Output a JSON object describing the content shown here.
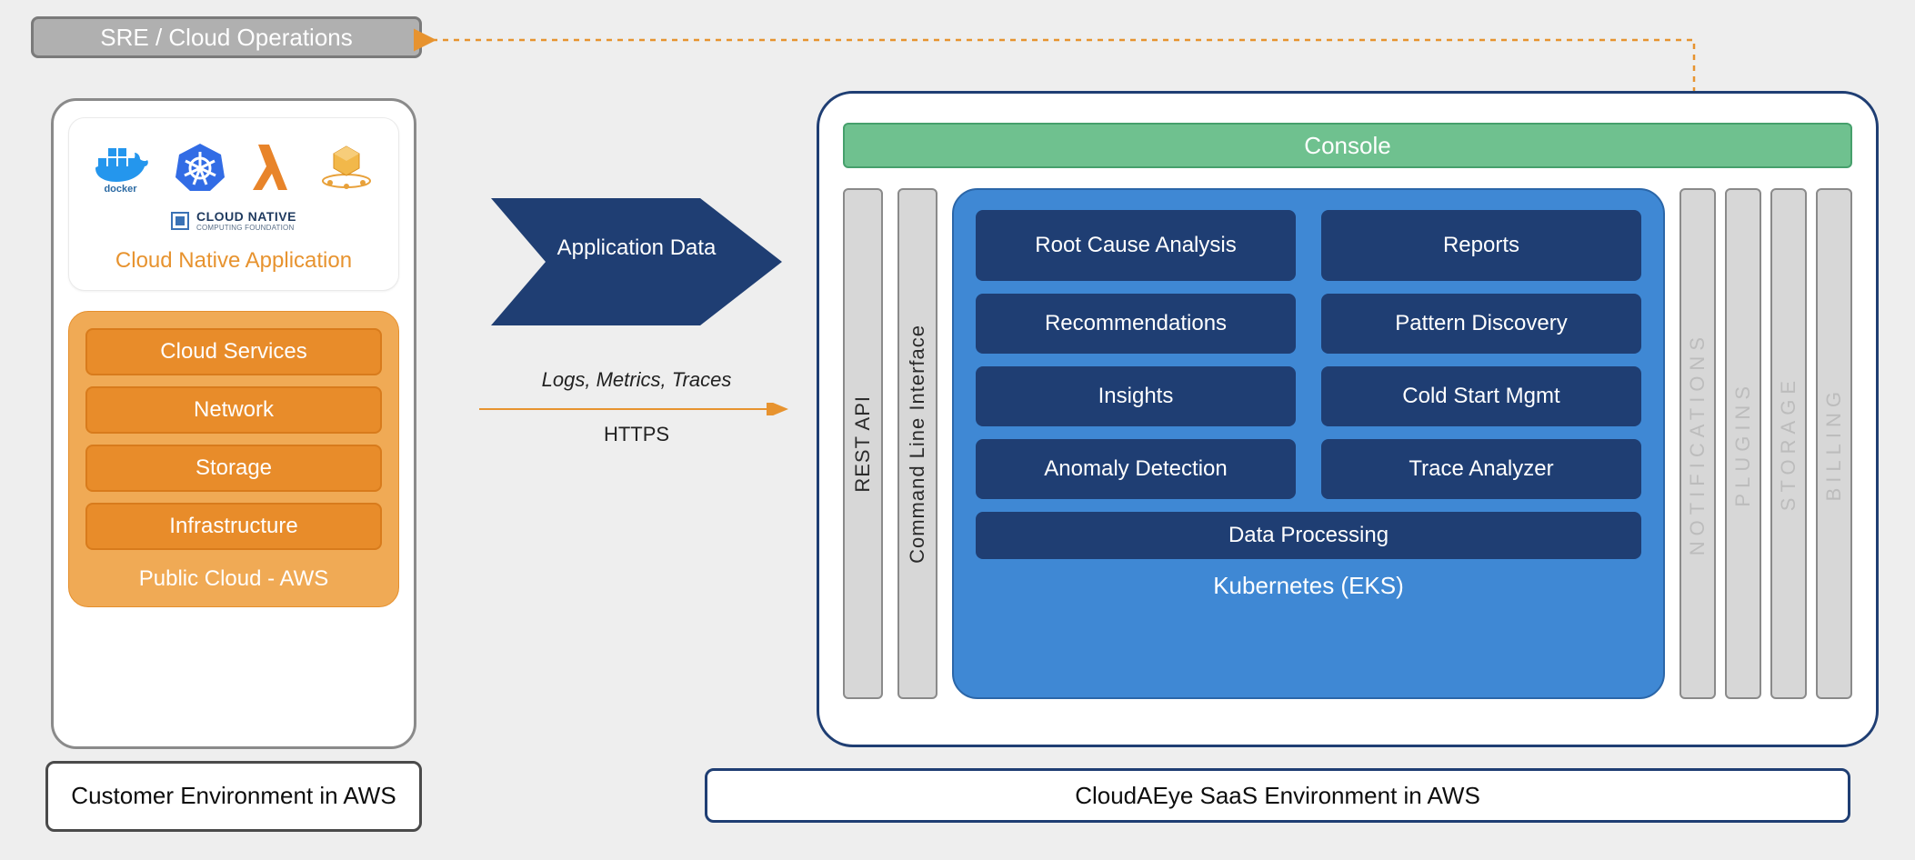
{
  "sre_label": "SRE / Cloud Operations",
  "customer_env_label": "Customer Environment in AWS",
  "saas_env_label": "CloudAEye SaaS Environment in AWS",
  "cloud_native": {
    "title": "Cloud Native Application",
    "icons": [
      "docker",
      "kubernetes",
      "lambda",
      "honeycomb"
    ],
    "cncf_label": "CLOUD NATIVE",
    "cncf_sub": "COMPUTING FOUNDATION"
  },
  "public_cloud": {
    "title": "Public Cloud - AWS",
    "services": [
      "Cloud Services",
      "Network",
      "Storage",
      "Infrastructure"
    ]
  },
  "flow": {
    "chevron_label": "Application Data",
    "types": "Logs, Metrics, Traces",
    "protocol": "HTTPS"
  },
  "saas": {
    "console_label": "Console",
    "rest_api": "REST API",
    "cli": "Command Line Interface",
    "k8s_title": "Kubernetes (EKS)",
    "grid_left": [
      "Root Cause Analysis",
      "Recommendations",
      "Insights",
      "Anomaly Detection"
    ],
    "grid_right": [
      "Reports",
      "Pattern Discovery",
      "Cold Start Mgmt",
      "Trace Analyzer"
    ],
    "data_processing": "Data  Processing",
    "side_columns": [
      "NOTIFICATIONS",
      "PLUGINS",
      "STORAGE",
      "BILLING"
    ]
  }
}
